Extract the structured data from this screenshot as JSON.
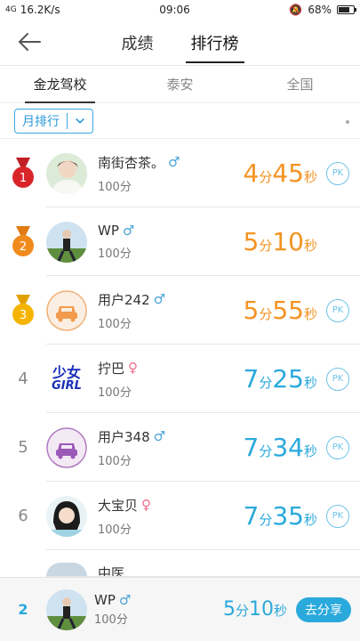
{
  "status": {
    "signal": "4G",
    "speed": "16.2K/s",
    "time": "09:06",
    "battery": "68%"
  },
  "nav": {
    "tabs": [
      "成绩",
      "排行榜"
    ],
    "active": 1
  },
  "subtabs": [
    "金龙驾校",
    "泰安",
    "全国"
  ],
  "filter": {
    "selected": "月排行"
  },
  "rows": [
    {
      "rank": "1",
      "name": "南街杏茶。",
      "gender": "♂",
      "points": "100分",
      "min": "4",
      "sec": "45",
      "unit_min": "分",
      "unit_sec": "秒",
      "pk": "PK",
      "color": "orange"
    },
    {
      "rank": "2",
      "name": "WP",
      "gender": "♂",
      "points": "100分",
      "min": "5",
      "sec": "10",
      "unit_min": "分",
      "unit_sec": "秒",
      "pk": "",
      "color": "orange"
    },
    {
      "rank": "3",
      "name": "用户242",
      "gender": "♂",
      "points": "100分",
      "min": "5",
      "sec": "55",
      "unit_min": "分",
      "unit_sec": "秒",
      "pk": "PK",
      "color": "orange"
    },
    {
      "rank": "4",
      "name": "拧巴",
      "gender": "♀",
      "points": "100分",
      "min": "7",
      "sec": "25",
      "unit_min": "分",
      "unit_sec": "秒",
      "pk": "PK",
      "color": "blue"
    },
    {
      "rank": "5",
      "name": "用户348",
      "gender": "♂",
      "points": "100分",
      "min": "7",
      "sec": "34",
      "unit_min": "分",
      "unit_sec": "秒",
      "pk": "PK",
      "color": "blue"
    },
    {
      "rank": "6",
      "name": "大宝贝",
      "gender": "♀",
      "points": "100分",
      "min": "7",
      "sec": "35",
      "unit_min": "分",
      "unit_sec": "秒",
      "pk": "PK",
      "color": "blue"
    }
  ],
  "partial_row": {
    "name": "中医"
  },
  "me": {
    "rank": "2",
    "name": "WP",
    "gender": "♂",
    "points": "100分",
    "min": "5",
    "sec": "10",
    "unit_min": "分",
    "unit_sec": "秒",
    "share": "去分享"
  },
  "avatar4_text": {
    "line1": "少女",
    "line2": "GIRL"
  },
  "colors": {
    "accent": "#2aa9dc",
    "orange": "#f39321",
    "gold": "#f5b400",
    "red_medal": "#d9252a",
    "orange_medal": "#f08a1c"
  }
}
